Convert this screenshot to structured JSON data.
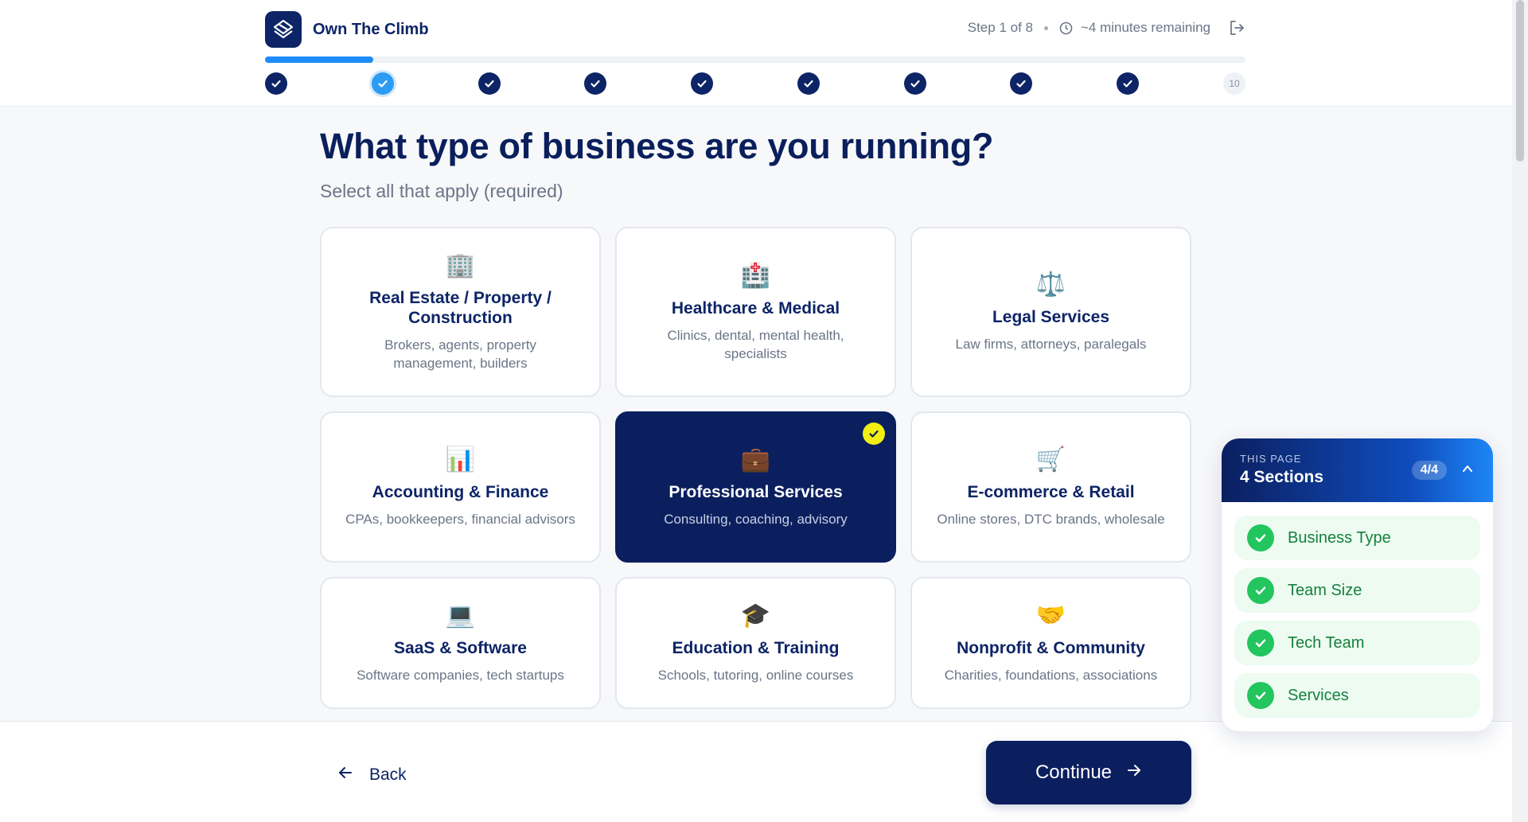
{
  "brand": {
    "name": "Own The Climb"
  },
  "header": {
    "step_text": "Step 1 of 8",
    "time_remaining": "~4 minutes remaining"
  },
  "progress": {
    "fraction": 0.11
  },
  "steps": [
    {
      "state": "done",
      "label": ""
    },
    {
      "state": "current",
      "label": ""
    },
    {
      "state": "done",
      "label": ""
    },
    {
      "state": "done",
      "label": ""
    },
    {
      "state": "done",
      "label": ""
    },
    {
      "state": "done",
      "label": ""
    },
    {
      "state": "done",
      "label": ""
    },
    {
      "state": "done",
      "label": ""
    },
    {
      "state": "done",
      "label": ""
    },
    {
      "state": "todo",
      "label": "10"
    }
  ],
  "main": {
    "title": "What type of business are you running?",
    "subtitle": "Select all that apply (required)"
  },
  "options": [
    {
      "icon": "🏢",
      "icon_name": "office-building-icon",
      "name": "Real Estate / Property / Construction",
      "desc": "Brokers, agents, property management, builders",
      "selected": false
    },
    {
      "icon": "🏥",
      "icon_name": "hospital-icon",
      "name": "Healthcare & Medical",
      "desc": "Clinics, dental, mental health, specialists",
      "selected": false
    },
    {
      "icon": "⚖️",
      "icon_name": "scales-icon",
      "name": "Legal Services",
      "desc": "Law firms, attorneys, paralegals",
      "selected": false
    },
    {
      "icon": "📊",
      "icon_name": "bar-chart-icon",
      "name": "Accounting & Finance",
      "desc": "CPAs, bookkeepers, financial advisors",
      "selected": false
    },
    {
      "icon": "💼",
      "icon_name": "briefcase-icon",
      "name": "Professional Services",
      "desc": "Consulting, coaching, advisory",
      "selected": true
    },
    {
      "icon": "🛒",
      "icon_name": "shopping-cart-icon",
      "name": "E-commerce & Retail",
      "desc": "Online stores, DTC brands, wholesale",
      "selected": false
    },
    {
      "icon": "💻",
      "icon_name": "laptop-icon",
      "name": "SaaS & Software",
      "desc": "Software companies, tech startups",
      "selected": false
    },
    {
      "icon": "🎓",
      "icon_name": "graduation-cap-icon",
      "name": "Education & Training",
      "desc": "Schools, tutoring, online courses",
      "selected": false
    },
    {
      "icon": "🤝",
      "icon_name": "handshake-icon",
      "name": "Nonprofit & Community",
      "desc": "Charities, foundations, associations",
      "selected": false
    }
  ],
  "footer": {
    "back_label": "Back",
    "continue_label": "Continue"
  },
  "panel": {
    "kicker": "THIS PAGE",
    "title": "4 Sections",
    "count": "4/4",
    "items": [
      {
        "label": "Business Type"
      },
      {
        "label": "Team Size"
      },
      {
        "label": "Tech Team"
      },
      {
        "label": "Services"
      }
    ]
  },
  "colors": {
    "navy": "#0b1f5f",
    "accent_blue": "#1d8cf8",
    "selected_check": "#f2ee12",
    "success_green": "#22c55e"
  }
}
